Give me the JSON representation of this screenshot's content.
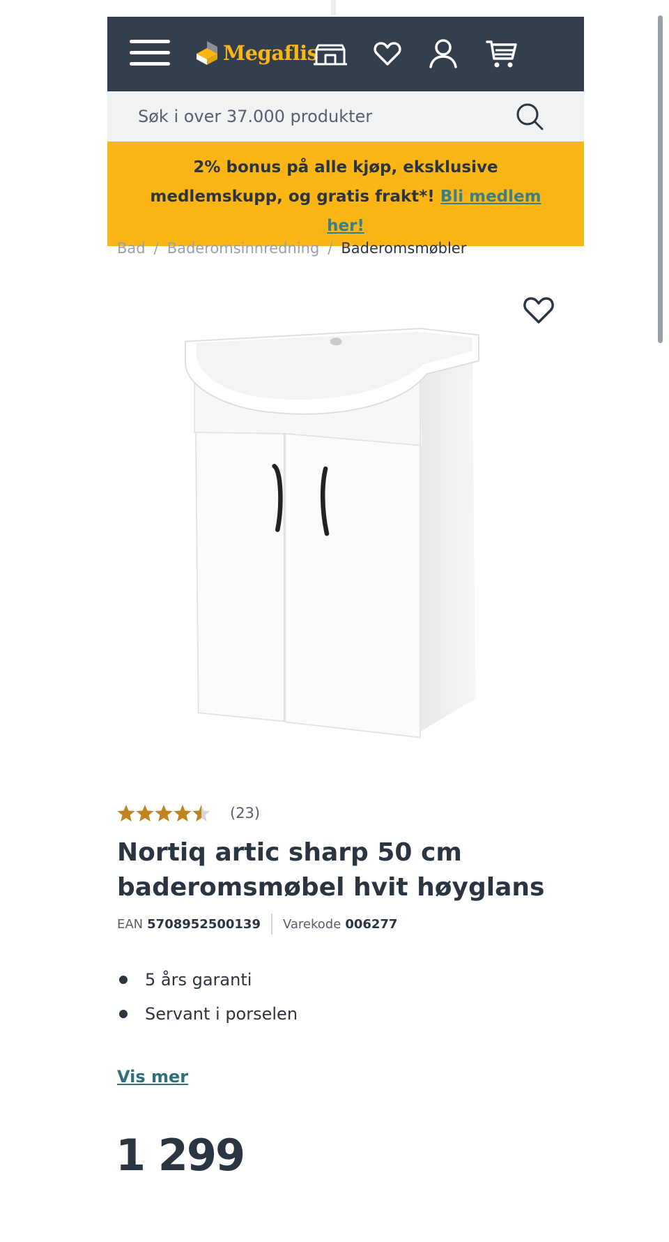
{
  "header": {
    "brand": "Megaflis",
    "icons": [
      "menu-icon",
      "store-icon",
      "heart-icon",
      "user-icon",
      "cart-icon"
    ],
    "colors": {
      "background": "#333f4c",
      "accent": "#fbb616"
    }
  },
  "search": {
    "placeholder": "Søk i over 37.000 produkter"
  },
  "promo": {
    "text": "2% bonus på alle kjøp, eksklusive medlemskupp, og gratis frakt*!",
    "link": "Bli medlem her!"
  },
  "breadcrumb": [
    "Bad",
    "Baderomsinnredning",
    "Baderomsmøbler"
  ],
  "product": {
    "rating": 4.5,
    "review_count": "(23)",
    "title": "Nortiq artic sharp 50 cm baderomsmøbel hvit høyglans",
    "ean_label": "EAN",
    "ean": "5708952500139",
    "code_label": "Varekode",
    "code": "006277",
    "features": [
      "5 års garanti",
      "Servant i porselen"
    ],
    "more_link": "Vis mer",
    "price": "1 299"
  }
}
